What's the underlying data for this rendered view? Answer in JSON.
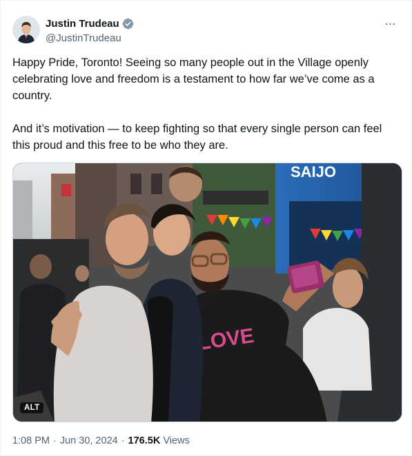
{
  "author": {
    "name": "Justin Trudeau",
    "handle": "@JustinTrudeau",
    "verified_badge_color": "#829aab"
  },
  "more_icon": "⋯",
  "tweet": {
    "paragraph_1": "Happy Pride, Toronto! Seeing so many people out in the Village openly celebrating love and freedom is a testament to how far we’ve come as a country.",
    "paragraph_2": "And it’s motivation — to keep fighting so that every single person can feel this proud and this free to be who they are."
  },
  "media": {
    "alt_badge": "ALT",
    "shirt_text": "LOVE",
    "storefront_sign": "SAIJO"
  },
  "meta": {
    "time": "1:08 PM",
    "separator": "·",
    "date": "Jun 30, 2024",
    "views_count": "176.5K",
    "views_label": "Views"
  },
  "colors": {
    "text_primary": "#0f1419",
    "text_secondary": "#536471",
    "border": "#cfd9de"
  }
}
